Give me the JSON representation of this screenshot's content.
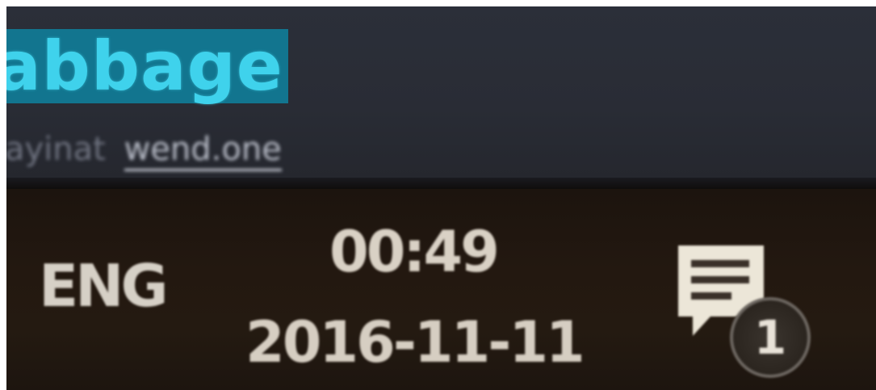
{
  "app": {
    "title": "abbage",
    "subtitle_prefix": "ayinat",
    "subtitle_link": "wend.one"
  },
  "taskbar": {
    "language": "ENG",
    "clock": {
      "time": "00:49",
      "date": "2016-11-11"
    },
    "notifications": {
      "icon": "action-center-icon",
      "count": "1"
    }
  },
  "colors": {
    "title_highlight_bg": "#12758f",
    "title_text": "#3fd2ec",
    "window_bg": "#2b2f39",
    "taskbar_bg": "#231810",
    "taskbar_text": "#d9d1c5"
  }
}
